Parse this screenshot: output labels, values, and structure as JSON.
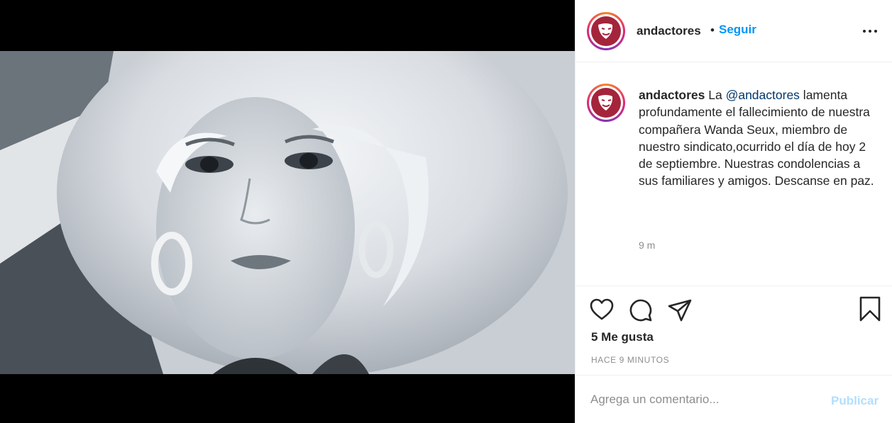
{
  "post": {
    "username": "andactores",
    "separator": "•",
    "follow_label": "Seguir",
    "more_label": "Más opciones"
  },
  "caption": {
    "username": "andactores",
    "text_before": "La ",
    "mention": "@andactores",
    "text_after": " lamenta profundamente el fallecimiento de nuestra compañera Wanda Seux, miembro de nuestro sindicato,ocurrido el día de hoy 2 de septiembre. Nuestras condolencias a sus familiares y amigos. Descanse en paz.",
    "time": "9 m"
  },
  "actions": {
    "likes": "5 Me gusta",
    "posted_ago": "HACE 9 MINUTOS"
  },
  "comment": {
    "placeholder": "Agrega un comentario...",
    "publish_label": "Publicar"
  },
  "icons": {
    "like": "heart-icon",
    "comment": "comment-bubble-icon",
    "share": "paper-plane-icon",
    "save": "bookmark-icon",
    "more": "ellipsis-icon"
  },
  "colors": {
    "brand_blue": "#0095f6",
    "publish_disabled": "#b2dffc",
    "avatar_bg": "#a4243b",
    "mention": "#00376b"
  }
}
